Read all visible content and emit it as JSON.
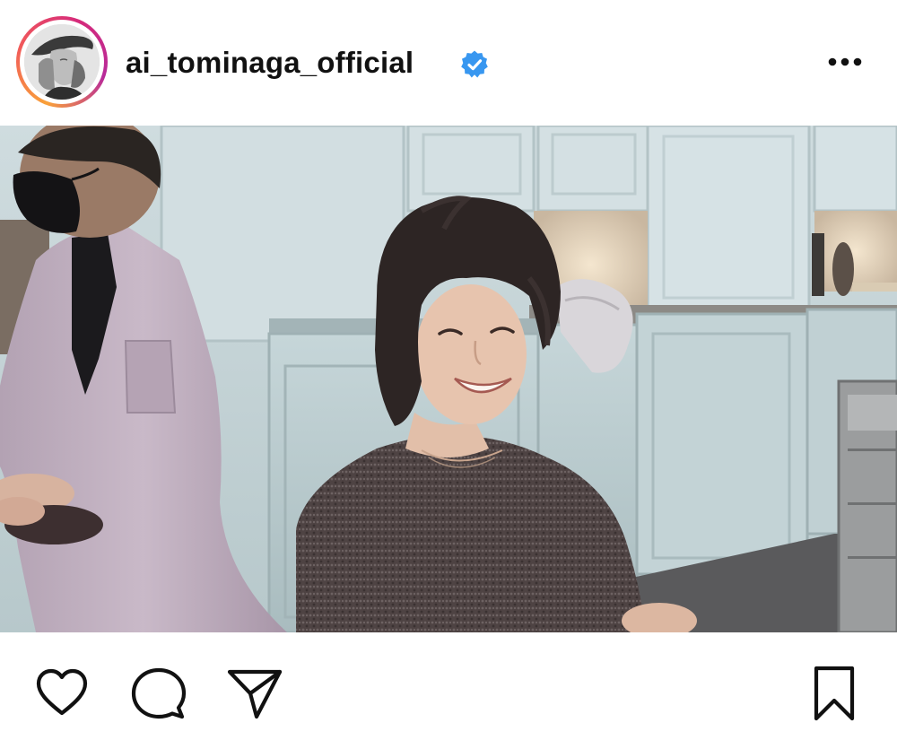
{
  "post": {
    "username": "ai_tominaga_official",
    "verified": true
  },
  "header_icons": {
    "verified": "verified-badge-icon",
    "more": "more-options-icon"
  },
  "action_icons": {
    "like": "heart-icon",
    "comment": "comment-bubble-icon",
    "share": "paper-plane-icon",
    "save": "bookmark-icon"
  },
  "colors": {
    "verified_blue": "#3897f0",
    "text": "#111111",
    "ring_gradient": [
      "#f9a13a",
      "#f15a5a",
      "#d62b7a",
      "#b82a9a"
    ]
  }
}
